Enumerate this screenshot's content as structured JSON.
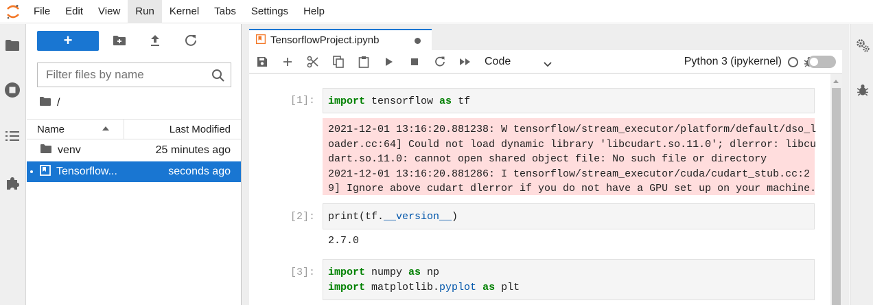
{
  "menubar": {
    "items": [
      "File",
      "Edit",
      "View",
      "Run",
      "Kernel",
      "Tabs",
      "Settings",
      "Help"
    ],
    "active": "Run"
  },
  "filebrowser": {
    "new_label": "+",
    "filter_placeholder": "Filter files by name",
    "breadcrumb": "/",
    "columns": {
      "name": "Name",
      "modified": "Last Modified"
    },
    "files": [
      {
        "name": "venv",
        "modified": "25 minutes ago",
        "icon": "folder-icon"
      },
      {
        "name": "Tensorflow...",
        "modified": "seconds ago",
        "icon": "notebook-icon",
        "selected": true
      }
    ]
  },
  "notebook": {
    "tab_title": "TensorflowProject.ipynb",
    "cell_type": "Code",
    "kernel": "Python 3 (ipykernel)",
    "cells": [
      {
        "prompt": "[1]:",
        "stderr": [
          "2021-12-01 13:16:20.881238: W tensorflow/stream_executor/platform/default/dso_l",
          "oader.cc:64] Could not load dynamic library 'libcudart.so.11.0'; dlerror: libcu",
          "dart.so.11.0: cannot open shared object file: No such file or directory",
          "2021-12-01 13:16:20.881286: I tensorflow/stream_executor/cuda/cudart_stub.cc:2",
          "9] Ignore above cudart dlerror if you do not have a GPU set up on your machine."
        ]
      },
      {
        "prompt": "[2]:",
        "output": "2.7.0"
      },
      {
        "prompt": "[3]:"
      }
    ]
  },
  "colors": {
    "accent": "#1976d2",
    "stderr_bg": "#ffdddd",
    "keyword": "#008000"
  }
}
